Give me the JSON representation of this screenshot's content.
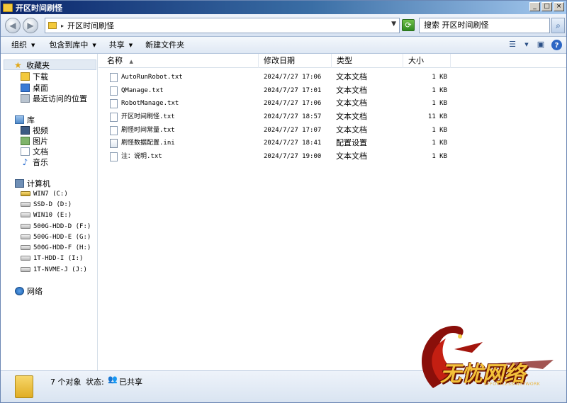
{
  "window": {
    "title": "开区时间刷怪",
    "controls": [
      "_",
      "□",
      "×"
    ]
  },
  "address": {
    "path": "开区时间刷怪",
    "search_placeholder": "搜索 开区时间刷怪"
  },
  "toolbar": {
    "organize": "组织",
    "include": "包含到库中",
    "share": "共享",
    "new_folder": "新建文件夹"
  },
  "nav": {
    "favorites": {
      "label": "收藏夹",
      "items": [
        "下载",
        "桌面",
        "最近访问的位置"
      ]
    },
    "libraries": {
      "label": "库",
      "items": [
        "视频",
        "图片",
        "文档",
        "音乐"
      ]
    },
    "computer": {
      "label": "计算机",
      "drives": [
        "WIN7 (C:)",
        "SSD-D (D:)",
        "WIN10 (E:)",
        "500G-HDD-D (F:)",
        "500G-HDD-E (G:)",
        "500G-HDD-F (H:)",
        "1T-HDD-I (I:)",
        "1T-NVME-J (J:)"
      ]
    },
    "network": {
      "label": "网络"
    }
  },
  "columns": {
    "name": "名称",
    "modified": "修改日期",
    "type": "类型",
    "size": "大小"
  },
  "files": [
    {
      "name": "AutoRunRobot.txt",
      "modified": "2024/7/27 17:06",
      "type": "文本文档",
      "size": "1 KB",
      "icon": "text-file-icon"
    },
    {
      "name": "QManage.txt",
      "modified": "2024/7/27 17:01",
      "type": "文本文档",
      "size": "1 KB",
      "icon": "text-file-icon"
    },
    {
      "name": "RobotManage.txt",
      "modified": "2024/7/27 17:06",
      "type": "文本文档",
      "size": "1 KB",
      "icon": "text-file-icon"
    },
    {
      "name": "开区时间刷怪.txt",
      "modified": "2024/7/27 18:57",
      "type": "文本文档",
      "size": "11 KB",
      "icon": "text-file-icon"
    },
    {
      "name": "刷怪时间常量.txt",
      "modified": "2024/7/27 17:07",
      "type": "文本文档",
      "size": "1 KB",
      "icon": "text-file-icon"
    },
    {
      "name": "刷怪数据配置.ini",
      "modified": "2024/7/27 18:41",
      "type": "配置设置",
      "size": "1 KB",
      "icon": "config-file-icon"
    },
    {
      "name": "注：说明.txt",
      "modified": "2024/7/27 19:00",
      "type": "文本文档",
      "size": "1 KB",
      "icon": "text-file-icon"
    }
  ],
  "details": {
    "count": "7 个对象",
    "state_label": "状态:",
    "state": "已共享"
  },
  "watermark": {
    "title": "无忧网络",
    "subtitle": "EFFORTLESS NETWORK"
  }
}
